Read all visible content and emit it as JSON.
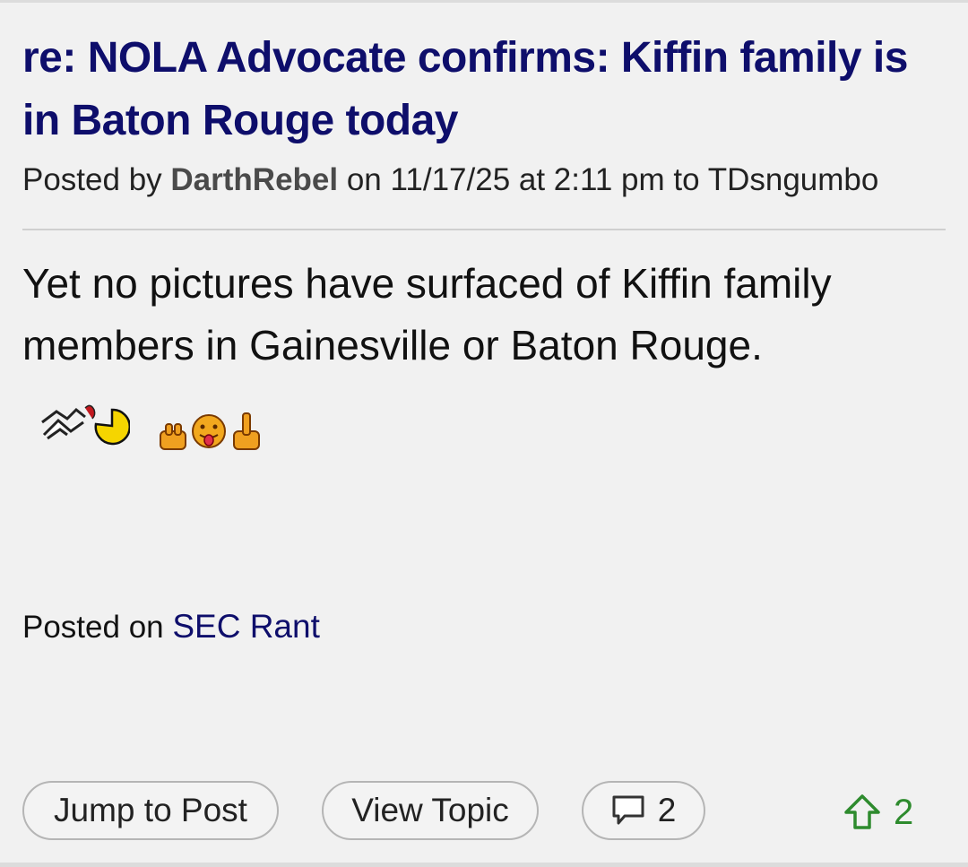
{
  "post": {
    "title": "re: NOLA Advocate confirms: Kiffin family is in Baton Rouge today",
    "meta": {
      "prefix": "Posted by",
      "author": "DarthRebel",
      "on": "on",
      "timestamp": "11/17/25 at 2:11 pm",
      "to": "to",
      "reply_to": "TDsngumbo"
    },
    "body": "Yet no pictures have surfaced of Kiffin family members in Gainesville or Baton Rouge.",
    "emojis": [
      "dancing-pacman-icon",
      "middle-fingers-tongue-icon"
    ],
    "posted_on": {
      "label": "Posted on",
      "board": "SEC Rant"
    }
  },
  "actions": {
    "jump_label": "Jump to Post",
    "topic_label": "View Topic",
    "reply_count": "2",
    "upvote_count": "2"
  },
  "colors": {
    "title": "#0e0e6b",
    "upvote": "#2e8b2e",
    "background": "#f1f1f1"
  }
}
